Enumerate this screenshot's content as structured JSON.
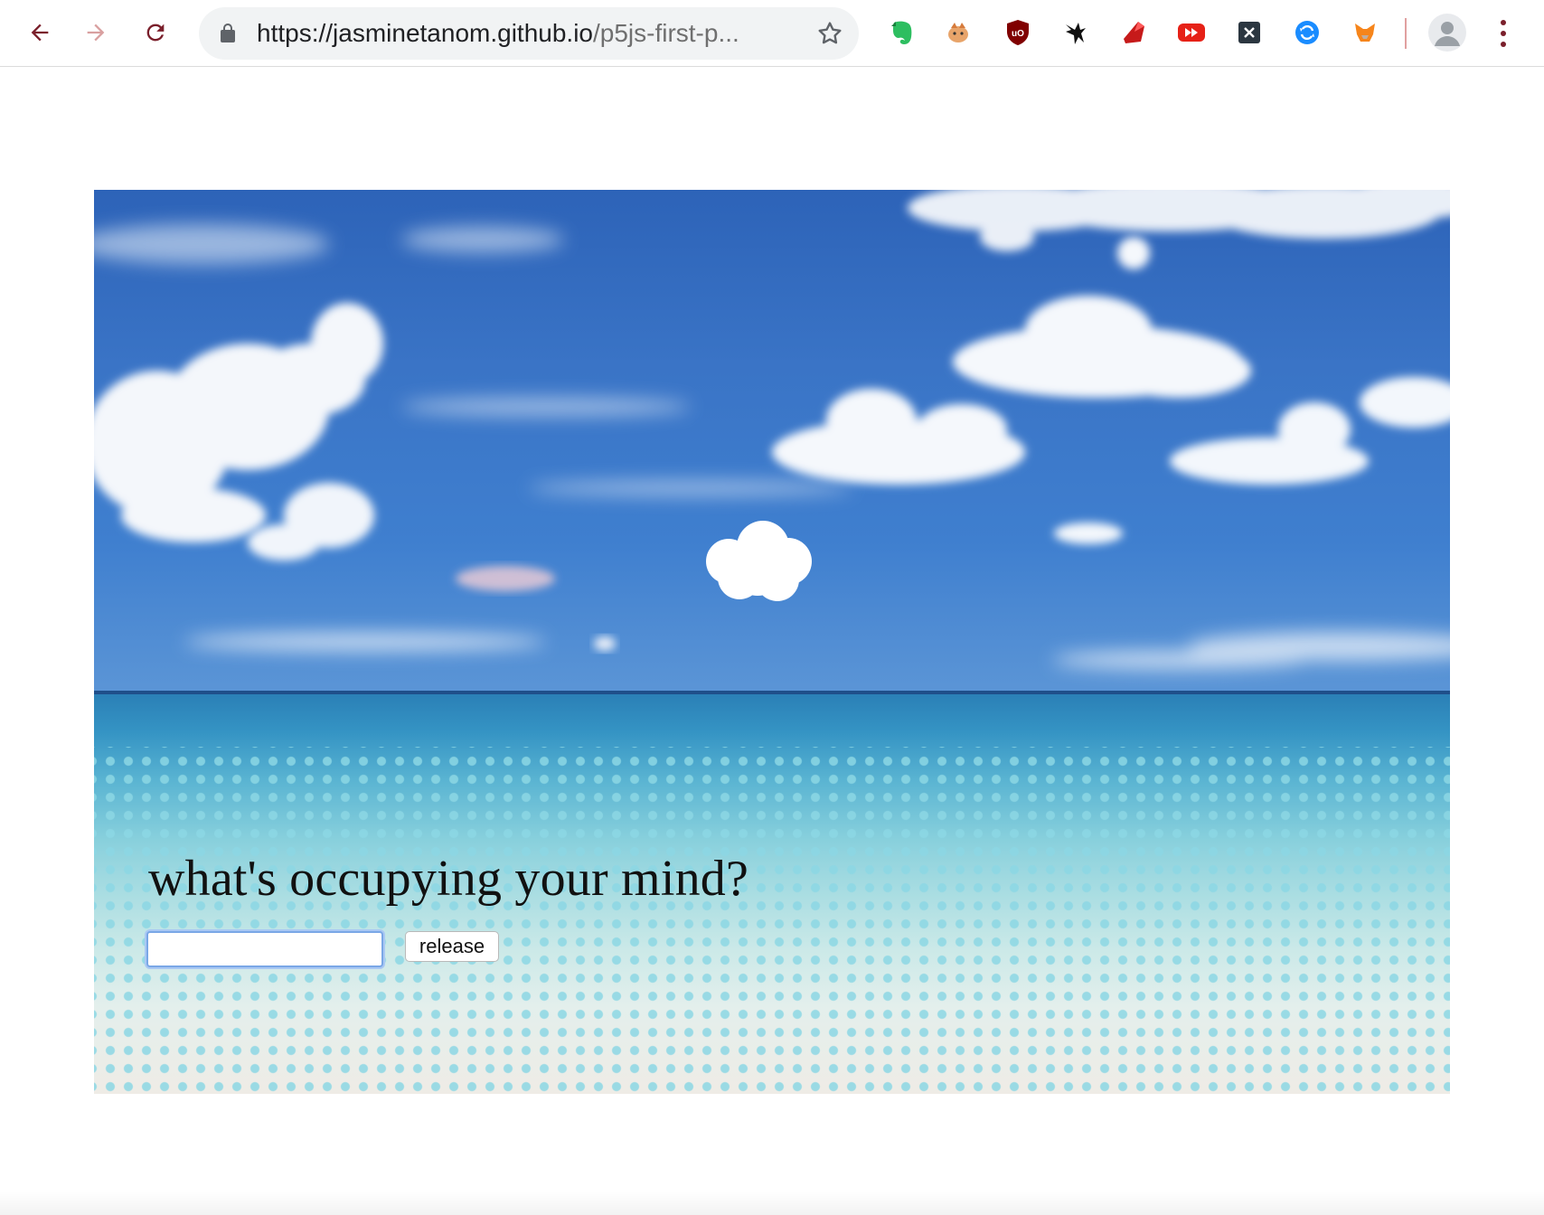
{
  "browser": {
    "url_host": "https://jasminetanom.github.io",
    "url_path": "/p5js-first-p...",
    "extensions": [
      "evernote-icon",
      "fox-extension-icon",
      "ublock-origin-icon",
      "bird-extension-icon",
      "ruby-icon",
      "youtube-forward-icon",
      "x-extension-icon",
      "sync-circle-icon",
      "metamask-icon"
    ],
    "colors": {
      "nav_icon": "#7a1f2b",
      "forward_icon": "#d9a0a0",
      "omnibox_bg": "#f1f3f4"
    }
  },
  "page": {
    "question": "what's occupying your mind?",
    "input_value": "",
    "release_label": "release",
    "colors": {
      "sky": "#3a74c6",
      "sea": "#5ab4d2",
      "sand": "#efece6",
      "dots": "#8cd7e4"
    }
  }
}
